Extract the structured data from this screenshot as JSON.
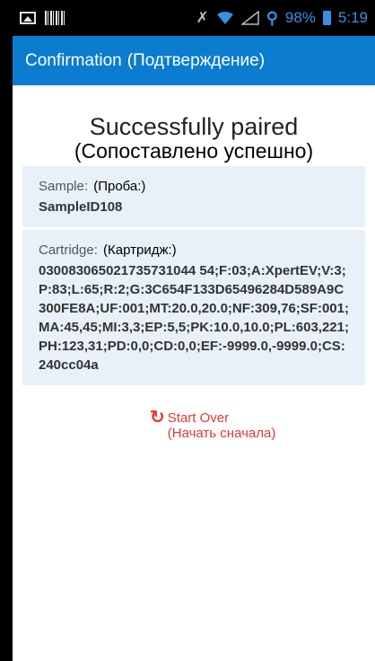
{
  "statusbar": {
    "battery_pct": "98%",
    "time": "5:19",
    "icons": [
      "image-icon",
      "barcode-icon",
      "mute-icon",
      "wifi-icon",
      "signal-icon",
      "usb-icon",
      "battery-icon"
    ],
    "accent": "#3a8ee6"
  },
  "appbar": {
    "title": "Confirmation",
    "title_ru": "(Подтверждение)",
    "color": "#0b7ccf"
  },
  "main": {
    "heading": "Successfully paired",
    "heading_ru": "(Сопоставлено успешно)",
    "sample": {
      "label": "Sample:",
      "label_ru": "(Проба:)",
      "value": "SampleID108"
    },
    "cartridge": {
      "label": "Cartridge:",
      "label_ru": "(Картридж:)",
      "value": "030083065021735731044 54;F:03;A:XpertEV;V:3;P:83;L:65;R:2;G:3C654F133D65496284D589A9C300FE8A;UF:001;MT:20.0,20.0;NF:309,76;SF:001;MA:45,45;MI:3,3;EP:5,5;PK:10.0,10.0;PL:603,221;PH:123,31;PD:0,0;CD:0,0;EF:-9999.0,-9999.0;CS:240cc04a"
    },
    "start_over": {
      "label": "Start Over",
      "label_ru": "(Начать сначала)",
      "color": "#e53935"
    }
  }
}
